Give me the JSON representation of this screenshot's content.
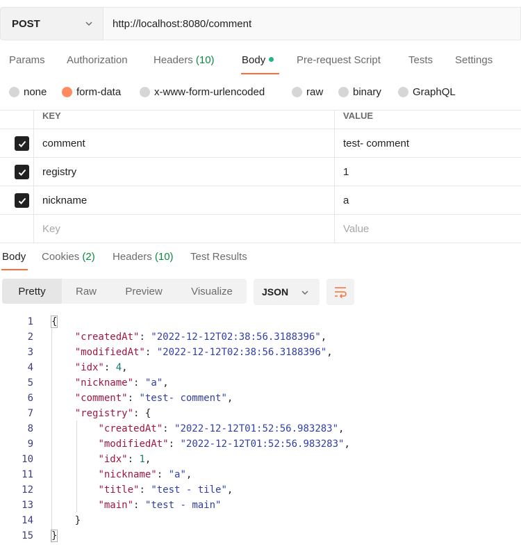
{
  "request": {
    "method": "POST",
    "url": "http://localhost:8080/comment"
  },
  "request_tabs": {
    "params": "Params",
    "authorization": "Authorization",
    "headers": "Headers",
    "headers_count": "(10)",
    "body": "Body",
    "pre_request": "Pre-request Script",
    "tests": "Tests",
    "settings": "Settings"
  },
  "body_types": {
    "none": "none",
    "form_data": "form-data",
    "urlencoded": "x-www-form-urlencoded",
    "raw": "raw",
    "binary": "binary",
    "graphql": "GraphQL"
  },
  "form_table": {
    "key_header": "KEY",
    "value_header": "VALUE",
    "rows": [
      {
        "key": "comment",
        "value": "test- comment"
      },
      {
        "key": "registry",
        "value": "1"
      },
      {
        "key": "nickname",
        "value": "a"
      }
    ],
    "key_placeholder": "Key",
    "value_placeholder": "Value"
  },
  "response_tabs": {
    "body": "Body",
    "cookies": "Cookies",
    "cookies_count": "(2)",
    "headers": "Headers",
    "headers_count": "(10)",
    "test_results": "Test Results"
  },
  "view": {
    "pretty": "Pretty",
    "raw": "Raw",
    "preview": "Preview",
    "visualize": "Visualize",
    "language": "JSON"
  },
  "response_json": {
    "line_numbers": [
      "1",
      "2",
      "3",
      "4",
      "5",
      "6",
      "7",
      "8",
      "9",
      "10",
      "11",
      "12",
      "13",
      "14",
      "15"
    ],
    "createdAt": "2022-12-12T02:38:56.3188396",
    "modifiedAt": "2022-12-12T02:38:56.3188396",
    "idx": "4",
    "nickname": "a",
    "comment": "test- comment",
    "registry": {
      "createdAt": "2022-12-12T01:52:56.983283",
      "modifiedAt": "2022-12-12T01:52:56.983283",
      "idx": "1",
      "nickname": "a",
      "title": "test - tile",
      "main": "test - main"
    }
  },
  "colors": {
    "accent": "#ff6c37",
    "body_dot": "#26b47f",
    "count_green": "#0b8a3e",
    "json_key": "#a3153f",
    "json_string": "#2f3fa8",
    "json_number": "#127a6e"
  }
}
